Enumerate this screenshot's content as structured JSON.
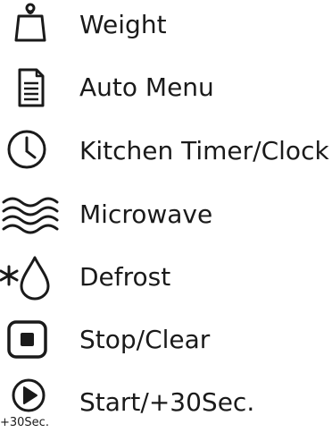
{
  "colors": {
    "ink": "#1a1a1a",
    "background": "#ffffff"
  },
  "items": [
    {
      "icon": "weight-icon",
      "label": "Weight"
    },
    {
      "icon": "document-icon",
      "label": "Auto Menu"
    },
    {
      "icon": "clock-icon",
      "label": "Kitchen Timer/Clock"
    },
    {
      "icon": "microwave-waves-icon",
      "label": "Microwave"
    },
    {
      "icon": "defrost-icon",
      "label": "Defrost"
    },
    {
      "icon": "stop-icon",
      "label": "Stop/Clear"
    },
    {
      "icon": "play-icon",
      "label": "Start/+30Sec.",
      "icon_caption": "+30Sec."
    }
  ]
}
